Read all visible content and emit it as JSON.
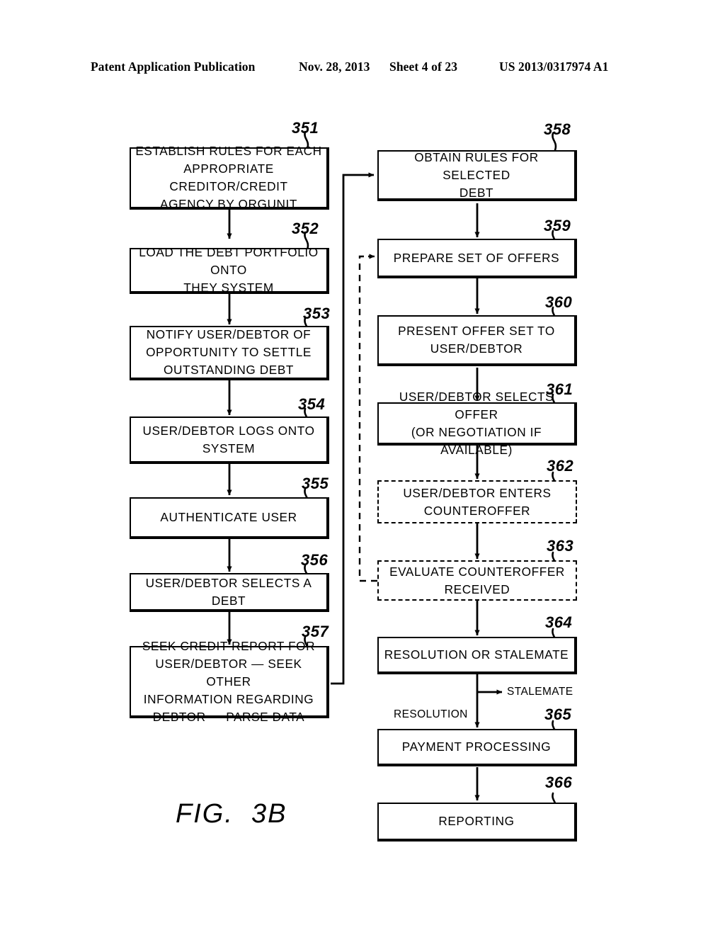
{
  "header": {
    "publication": "Patent Application Publication",
    "date": "Nov. 28, 2013",
    "sheet": "Sheet 4 of 23",
    "patent_number": "US 2013/0317974 A1"
  },
  "figure": {
    "caption": "FIG.  3B"
  },
  "nodes": [
    {
      "ref": "351",
      "text": "ESTABLISH RULES FOR EACH\nAPPROPRIATE CREDITOR/CREDIT\nAGENCY BY ORGUNIT",
      "style": "solid"
    },
    {
      "ref": "352",
      "text": "LOAD THE DEBT PORTFOLIO ONTO\nTHEY SYSTEM",
      "style": "solid"
    },
    {
      "ref": "353",
      "text": "NOTIFY USER/DEBTOR OF\nOPPORTUNITY TO SETTLE\nOUTSTANDING DEBT",
      "style": "solid"
    },
    {
      "ref": "354",
      "text": "USER/DEBTOR LOGS ONTO\nSYSTEM",
      "style": "solid"
    },
    {
      "ref": "355",
      "text": "AUTHENTICATE USER",
      "style": "solid"
    },
    {
      "ref": "356",
      "text": "USER/DEBTOR SELECTS A DEBT",
      "style": "solid"
    },
    {
      "ref": "357",
      "text": "SEEK CREDIT REPORT FOR\nUSER/DEBTOR — SEEK OTHER\nINFORMATION REGARDING\nDEBTOR — PARSE DATA",
      "style": "solid"
    },
    {
      "ref": "358",
      "text": "OBTAIN RULES FOR SELECTED\nDEBT",
      "style": "solid"
    },
    {
      "ref": "359",
      "text": "PREPARE SET OF OFFERS",
      "style": "solid"
    },
    {
      "ref": "360",
      "text": "PRESENT OFFER SET TO\nUSER/DEBTOR",
      "style": "solid"
    },
    {
      "ref": "361",
      "text": "USER/DEBTOR SELECTS OFFER\n(OR NEGOTIATION IF AVAILABLE)",
      "style": "solid"
    },
    {
      "ref": "362",
      "text": "USER/DEBTOR ENTERS\nCOUNTEROFFER",
      "style": "dashed"
    },
    {
      "ref": "363",
      "text": "EVALUATE COUNTEROFFER\nRECEIVED",
      "style": "dashed"
    },
    {
      "ref": "364",
      "text": "RESOLUTION OR STALEMATE",
      "style": "solid"
    },
    {
      "ref": "365",
      "text": "PAYMENT PROCESSING",
      "style": "solid"
    },
    {
      "ref": "366",
      "text": "REPORTING",
      "style": "solid"
    }
  ],
  "branch_labels": {
    "stalemate": "STALEMATE",
    "resolution": "RESOLUTION"
  }
}
